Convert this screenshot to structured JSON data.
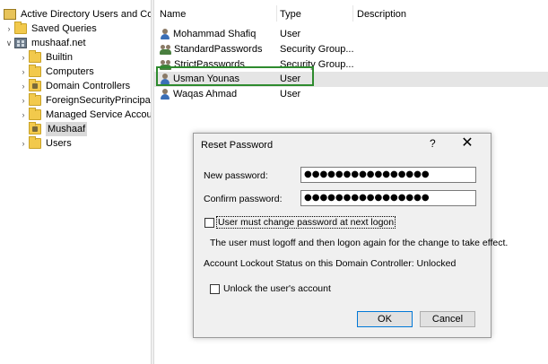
{
  "tree": {
    "root": "Active Directory Users and Com",
    "saved_queries": "Saved Queries",
    "domain": "mushaaf.net",
    "items": [
      {
        "label": "Builtin",
        "kind": "folder"
      },
      {
        "label": "Computers",
        "kind": "folder"
      },
      {
        "label": "Domain Controllers",
        "kind": "ou"
      },
      {
        "label": "ForeignSecurityPrincipals",
        "kind": "folder"
      },
      {
        "label": "Managed Service Accoun",
        "kind": "folder"
      },
      {
        "label": "Mushaaf",
        "kind": "ou",
        "selected": true
      },
      {
        "label": "Users",
        "kind": "folder"
      }
    ]
  },
  "list": {
    "columns": [
      "Name",
      "Type",
      "Description"
    ],
    "rows": [
      {
        "name": "Mohammad Shafiq",
        "type": "User",
        "icon": "user-icon"
      },
      {
        "name": "StandardPasswords",
        "type": "Security Group...",
        "icon": "group-icon"
      },
      {
        "name": "StrictPasswords",
        "type": "Security Group...",
        "icon": "group-icon"
      },
      {
        "name": "Usman Younas",
        "type": "User",
        "icon": "user-icon",
        "highlighted": true
      },
      {
        "name": "Waqas Ahmad",
        "type": "User",
        "icon": "user-icon"
      }
    ]
  },
  "dialog": {
    "title": "Reset Password",
    "help": "?",
    "close": "✕",
    "new_password_label": "New password:",
    "new_password_value": "●●●●●●●●●●●●●●●●",
    "confirm_password_label": "Confirm password:",
    "confirm_password_value": "●●●●●●●●●●●●●●●●",
    "must_change_label": "User must change password at next logon",
    "must_change_checked": false,
    "logoff_note": "The user must logoff and then logon again for the change to take effect.",
    "lockout_status": "Account Lockout Status on this Domain Controller: Unlocked",
    "unlock_label": "Unlock the user's account",
    "unlock_checked": false,
    "ok_label": "OK",
    "cancel_label": "Cancel"
  },
  "colors": {
    "highlight_box": "#2e8b2e",
    "selected_row": "#e5e5e5",
    "default_button_border": "#0078d7"
  }
}
